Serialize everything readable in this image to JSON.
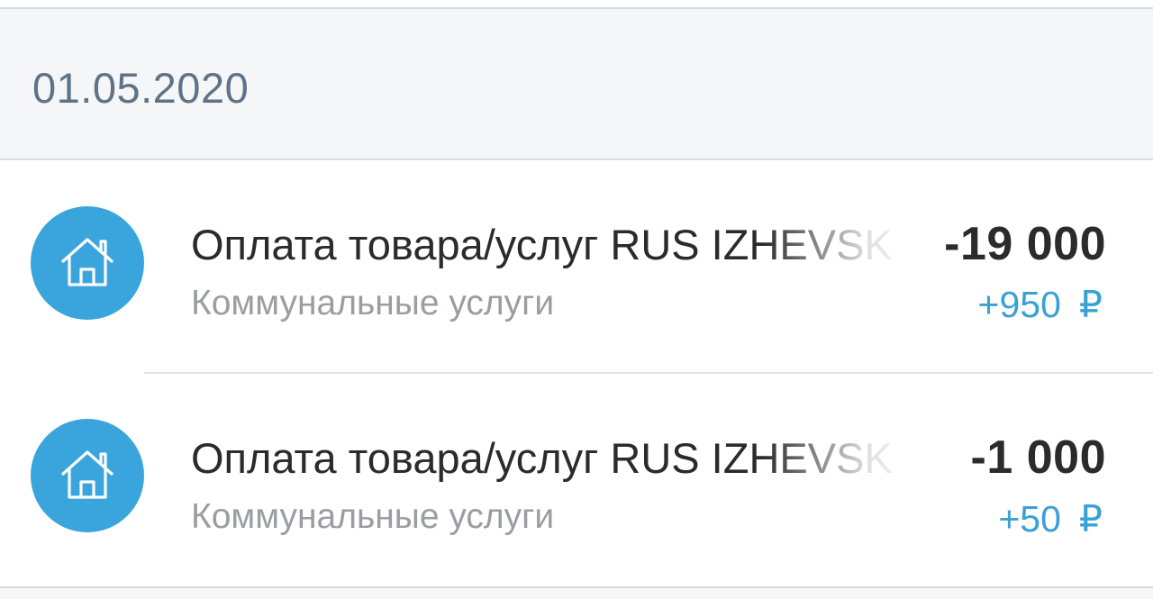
{
  "date_header": "01.05.2020",
  "colors": {
    "accent": "#3aa5dd",
    "cashback": "#3aa0d6",
    "header_bg": "#f5f6f8",
    "date_text": "#5f7386",
    "title_text": "#2b2b2b",
    "category_text": "#9a9da2"
  },
  "transactions": [
    {
      "icon": "house-icon",
      "title": "Оплата товара/услуг RUS IZHEVSK",
      "category": "Коммунальные услуги",
      "amount": "-19 000",
      "cashback_value": "+950",
      "cashback_currency": "₽"
    },
    {
      "icon": "house-icon",
      "title": "Оплата товара/услуг RUS IZHEVSK",
      "category": "Коммунальные услуги",
      "amount": "-1 000",
      "cashback_value": "+50",
      "cashback_currency": "₽"
    }
  ]
}
